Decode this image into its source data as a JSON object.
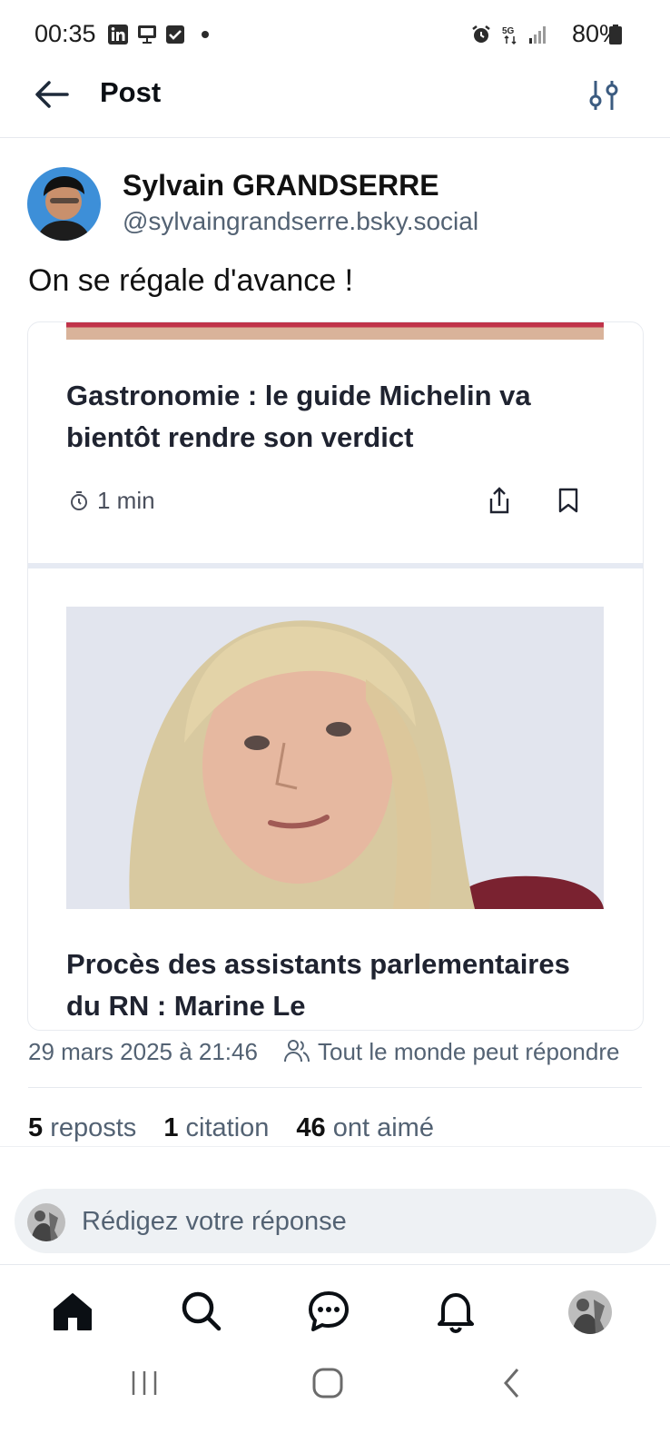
{
  "status_bar": {
    "time": "00:35",
    "left_icons": [
      "linkedin-icon",
      "presentation-icon",
      "checkbox-icon",
      "dot-icon"
    ],
    "right_icons": [
      "alarm-icon",
      "5g-icon",
      "signal-icon",
      "battery-icon"
    ],
    "battery": "80%"
  },
  "header": {
    "title": "Post",
    "back_icon": "arrow-left-icon",
    "filter_icon": "sliders-icon"
  },
  "post": {
    "author_name": "Sylvain GRANDSERRE",
    "author_handle": "@sylvaingrandserre.bsky.social",
    "text": "On se régale d'avance !",
    "embed": {
      "article1_title": "Gastronomie : le guide Michelin va bientôt rendre son verdict",
      "article1_time": "1 min",
      "article2_title": "Procès des assistants parlementaires du RN : Marine Le"
    },
    "date": "29 mars 2025 à 21:46",
    "reply_setting": "Tout le monde peut répondre"
  },
  "stats": {
    "reposts_count": "5",
    "reposts_label": "reposts",
    "quotes_count": "1",
    "quotes_label": "citation",
    "likes_count": "46",
    "likes_label": "ont aimé"
  },
  "reply": {
    "placeholder": "Rédigez votre réponse"
  },
  "nav": {
    "items": [
      "home-icon",
      "search-icon",
      "chat-icon",
      "bell-icon",
      "profile-avatar"
    ]
  },
  "colors": {
    "accent": "#0b0f14",
    "muted": "#536273",
    "separator": "#e6eaf3"
  }
}
